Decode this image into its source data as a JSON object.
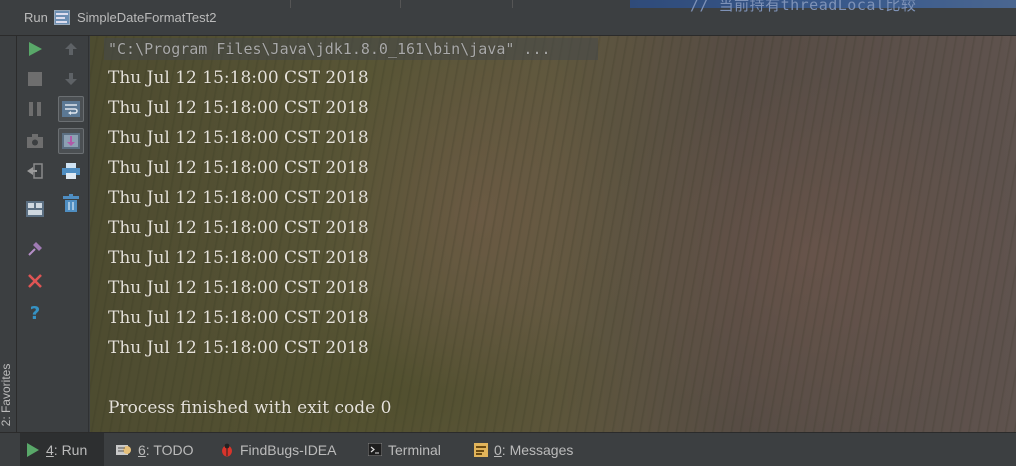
{
  "titlebar": {
    "run_label": "Run",
    "config_name": "SimpleDateFormatTest2",
    "background_snippet": "// 当前持有threadLocal比较"
  },
  "favorites": {
    "label": "2: Favorites"
  },
  "toolbar": {
    "col1": [
      "run-icon",
      "stop-icon",
      "pause-icon",
      "camera-icon",
      "exit-icon",
      "layout-icon",
      "pin-icon",
      "close-icon",
      "help-icon"
    ],
    "col2": [
      "up-arrow-icon",
      "down-arrow-icon",
      "soft-wrap-icon",
      "scroll-to-end-icon",
      "print-icon",
      "trash-icon"
    ]
  },
  "console": {
    "command": "\"C:\\Program Files\\Java\\jdk1.8.0_161\\bin\\java\" ...",
    "output_lines": [
      "Thu Jul 12 15:18:00 CST 2018",
      "Thu Jul 12 15:18:00 CST 2018",
      "Thu Jul 12 15:18:00 CST 2018",
      "Thu Jul 12 15:18:00 CST 2018",
      "Thu Jul 12 15:18:00 CST 2018",
      "Thu Jul 12 15:18:00 CST 2018",
      "Thu Jul 12 15:18:00 CST 2018",
      "Thu Jul 12 15:18:00 CST 2018",
      "Thu Jul 12 15:18:00 CST 2018",
      "Thu Jul 12 15:18:00 CST 2018"
    ],
    "blank": "",
    "exit_message": "Process finished with exit code 0"
  },
  "statusbar": {
    "run": {
      "mnemonic": "4",
      "label": ": Run"
    },
    "todo": {
      "mnemonic": "6",
      "label": ": TODO"
    },
    "findbugs": {
      "label": "FindBugs-IDEA"
    },
    "terminal": {
      "label": "Terminal"
    },
    "messages": {
      "mnemonic": "0",
      "label": ": Messages"
    }
  },
  "colors": {
    "panel": "#3c3f41",
    "run_green": "#59a869",
    "error_red": "#e05555",
    "help_blue": "#3592c4"
  }
}
